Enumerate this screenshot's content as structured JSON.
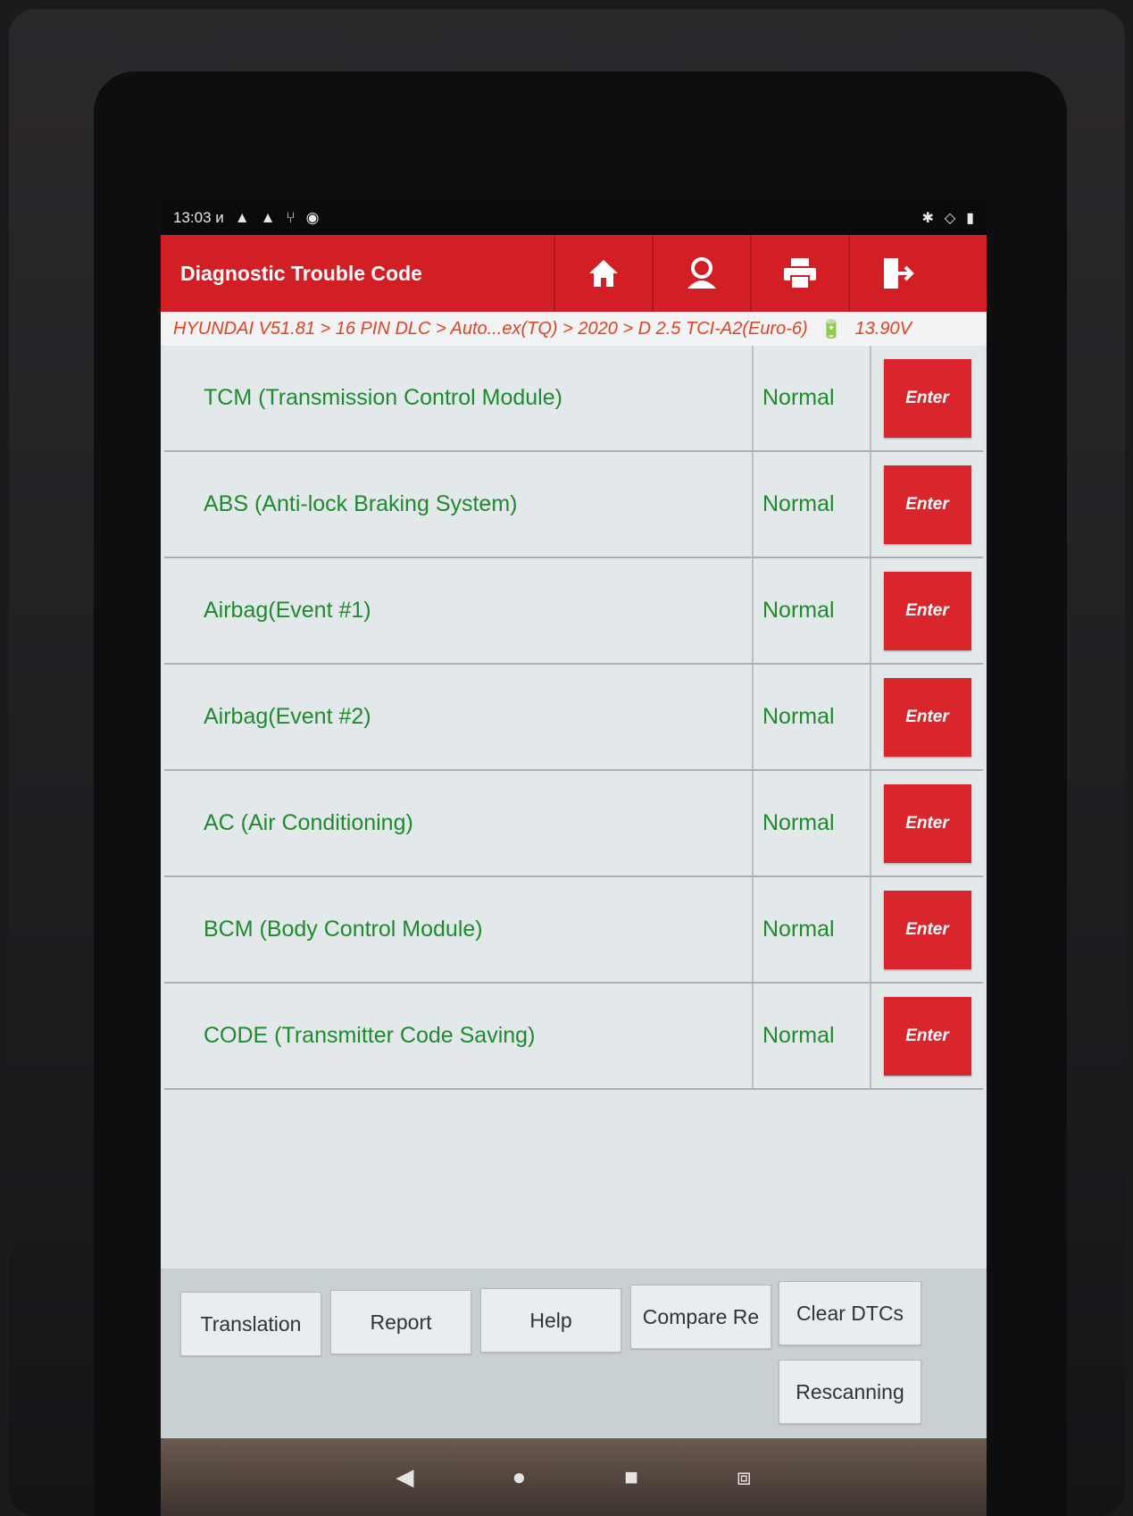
{
  "status_bar": {
    "time": "13:03 ",
    "indicator": "и"
  },
  "header": {
    "title": "Diagnostic Trouble Code"
  },
  "breadcrumb": {
    "path": "HYUNDAI V51.81 > 16 PIN DLC > Auto...ex(TQ) > 2020 > D 2.5 TCI-A2(Euro-6)",
    "voltage": "13.90V"
  },
  "modules": [
    {
      "name": "TCM (Transmission Control Module)",
      "status": "Normal",
      "action": "Enter"
    },
    {
      "name": "ABS (Anti-lock Braking System)",
      "status": "Normal",
      "action": "Enter"
    },
    {
      "name": "Airbag(Event #1)",
      "status": "Normal",
      "action": "Enter"
    },
    {
      "name": "Airbag(Event #2)",
      "status": "Normal",
      "action": "Enter"
    },
    {
      "name": "AC (Air Conditioning)",
      "status": "Normal",
      "action": "Enter"
    },
    {
      "name": "BCM (Body Control Module)",
      "status": "Normal",
      "action": "Enter"
    },
    {
      "name": "CODE (Transmitter Code Saving)",
      "status": "Normal",
      "action": "Enter"
    }
  ],
  "toolbar": {
    "translation": "Translation",
    "report": "Report",
    "help": "Help",
    "compare": "Compare Re",
    "clear_dtcs": "Clear DTCs",
    "rescanning": "Rescanning"
  },
  "colors": {
    "accent_red": "#d21f26",
    "status_green": "#1f8a2e",
    "breadcrumb_orange": "#e04322"
  }
}
